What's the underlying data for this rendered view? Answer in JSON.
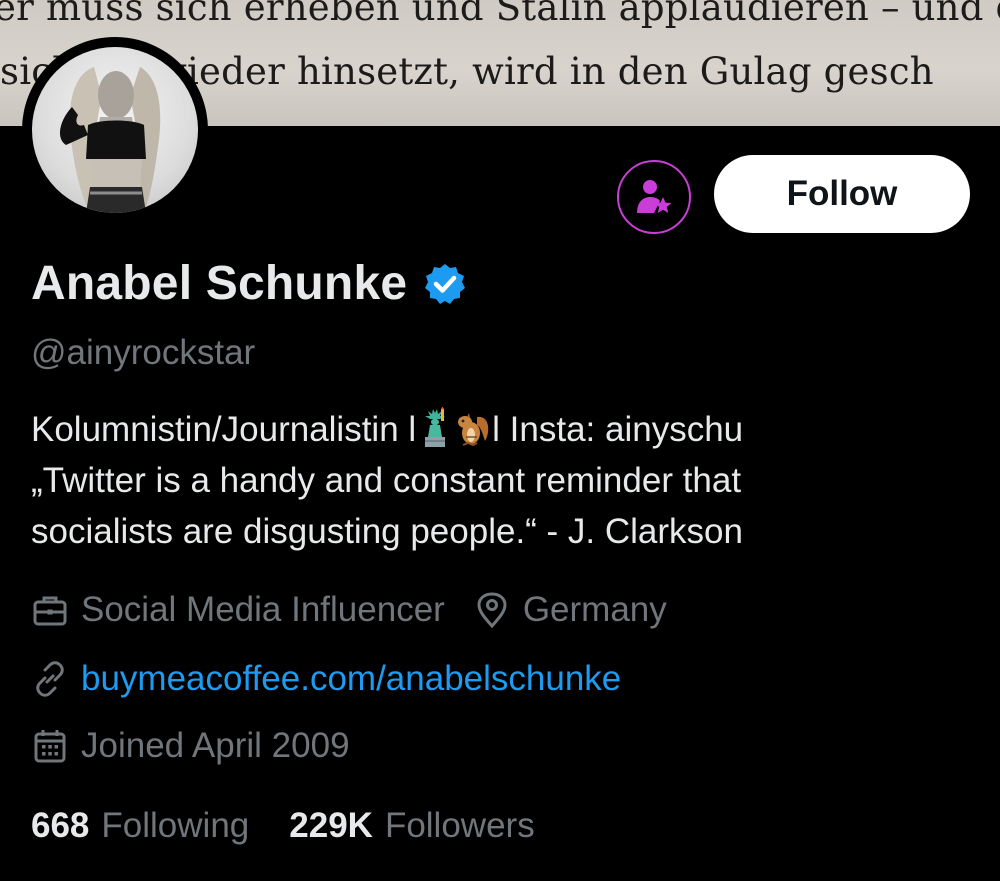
{
  "banner": {
    "line1": "er muss sich erheben und Stalin applaudieren – und der",
    "line2": "sich          ter wieder hinsetzt, wird in den Gulag gesch"
  },
  "profile": {
    "name": "Anabel Schunke",
    "handle": "@ainyrockstar",
    "verified": true,
    "bio_line1_a": "Kolumnistin/Journalistin l",
    "bio_line1_b": "l Insta: ainyschu",
    "bio_line2": "„Twitter is a handy and constant reminder that",
    "bio_line3": "socialists are disgusting people.“ - J. Clarkson",
    "emojis": [
      "statue-of-liberty-emoji",
      "chipmunk-emoji"
    ],
    "category": "Social Media Influencer",
    "location": "Germany",
    "website": "buymeacoffee.com/anabelschunke",
    "joined": "Joined April 2009",
    "following_count": "668",
    "following_label": "Following",
    "followers_count": "229K",
    "followers_label": "Followers"
  },
  "actions": {
    "follow_label": "Follow",
    "subscribe_icon": "person-star-icon"
  },
  "colors": {
    "background": "#000000",
    "text": "#e7e9ea",
    "muted": "#71767b",
    "link": "#1d9bf0",
    "verified": "#1d9bf0",
    "subscribe_accent": "#c93ed6"
  }
}
